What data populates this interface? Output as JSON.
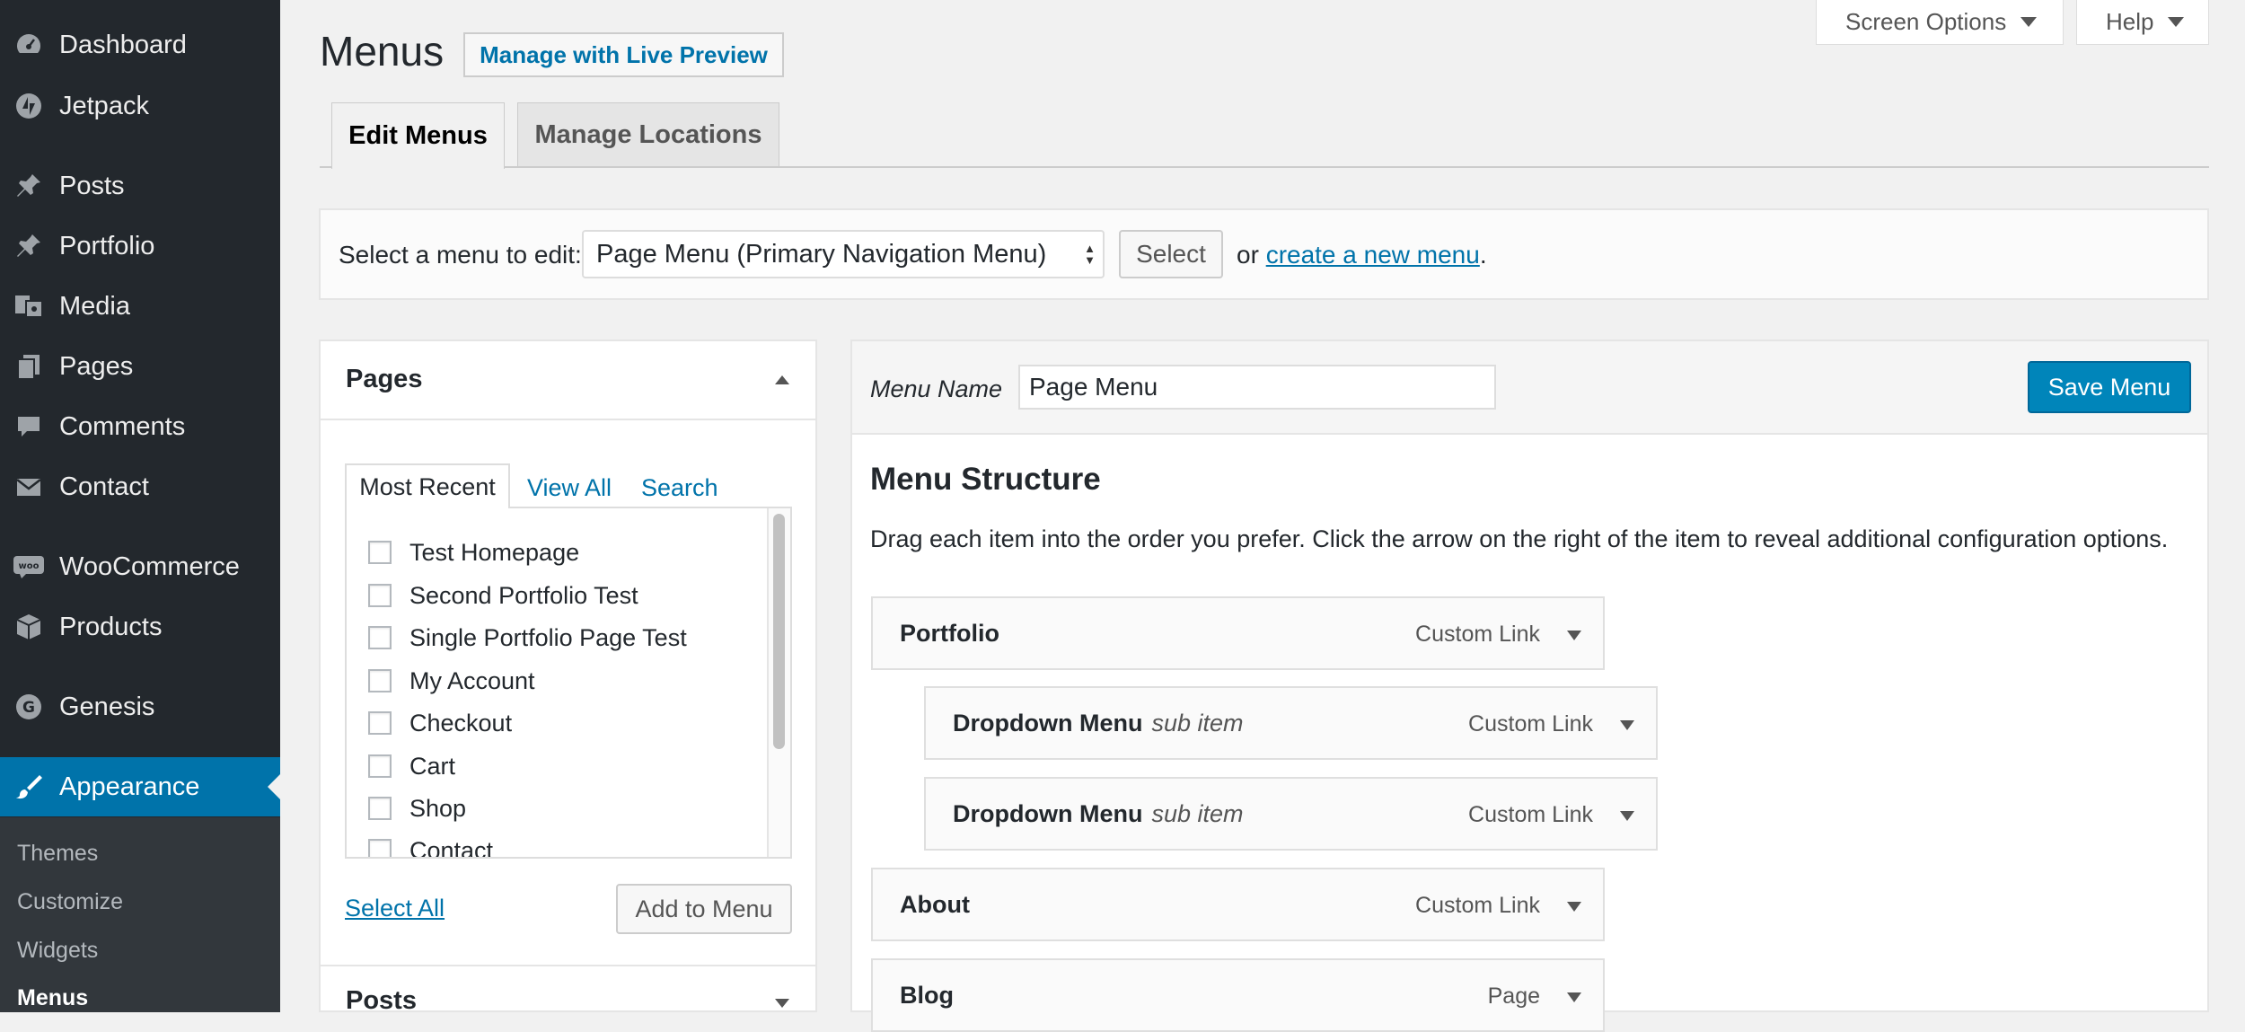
{
  "sidebar": {
    "items": [
      {
        "label": "Dashboard",
        "icon": "dashboard-icon"
      },
      {
        "label": "Jetpack",
        "icon": "jetpack-icon"
      },
      {
        "label": "Posts",
        "icon": "pin-icon"
      },
      {
        "label": "Portfolio",
        "icon": "pin-icon"
      },
      {
        "label": "Media",
        "icon": "media-icon"
      },
      {
        "label": "Pages",
        "icon": "pages-icon"
      },
      {
        "label": "Comments",
        "icon": "comment-icon"
      },
      {
        "label": "Contact",
        "icon": "mail-icon"
      },
      {
        "label": "WooCommerce",
        "icon": "woo-icon"
      },
      {
        "label": "Products",
        "icon": "box-icon"
      },
      {
        "label": "Genesis",
        "icon": "genesis-icon"
      },
      {
        "label": "Appearance",
        "icon": "brush-icon"
      }
    ],
    "submenu": [
      "Themes",
      "Customize",
      "Widgets",
      "Menus"
    ]
  },
  "top_tabs": {
    "screen_options": "Screen Options",
    "help": "Help"
  },
  "page": {
    "title": "Menus",
    "live_preview": "Manage with Live Preview"
  },
  "tabs": {
    "edit": "Edit Menus",
    "locations": "Manage Locations"
  },
  "select_bar": {
    "label": "Select a menu to edit:",
    "selected": "Page Menu (Primary Navigation Menu)",
    "button": "Select",
    "or": "or",
    "create_link": "create a new menu",
    "period": "."
  },
  "pages_panel": {
    "title": "Pages",
    "tabs": [
      "Most Recent",
      "View All",
      "Search"
    ],
    "pages": [
      "Test Homepage",
      "Second Portfolio Test",
      "Single Portfolio Page Test",
      "My Account",
      "Checkout",
      "Cart",
      "Shop",
      "Contact"
    ],
    "select_all": "Select All",
    "add_button": "Add to Menu",
    "next_section": "Posts"
  },
  "menu_panel": {
    "name_label": "Menu Name",
    "name_value": "Page Menu",
    "save_button": "Save Menu",
    "structure_title": "Menu Structure",
    "structure_desc": "Drag each item into the order you prefer. Click the arrow on the right of the item to reveal additional configuration options.",
    "items": [
      {
        "title": "Portfolio",
        "sub": "",
        "type": "Custom Link"
      },
      {
        "title": "Dropdown Menu",
        "sub": "sub item",
        "type": "Custom Link"
      },
      {
        "title": "Dropdown Menu",
        "sub": "sub item",
        "type": "Custom Link"
      },
      {
        "title": "About",
        "sub": "",
        "type": "Custom Link"
      },
      {
        "title": "Blog",
        "sub": "",
        "type": "Page"
      }
    ]
  },
  "colors": {
    "sidebar_bg": "#23282d",
    "active_bg": "#0073aa",
    "link": "#0073aa",
    "primary_button": "#0085ba"
  }
}
